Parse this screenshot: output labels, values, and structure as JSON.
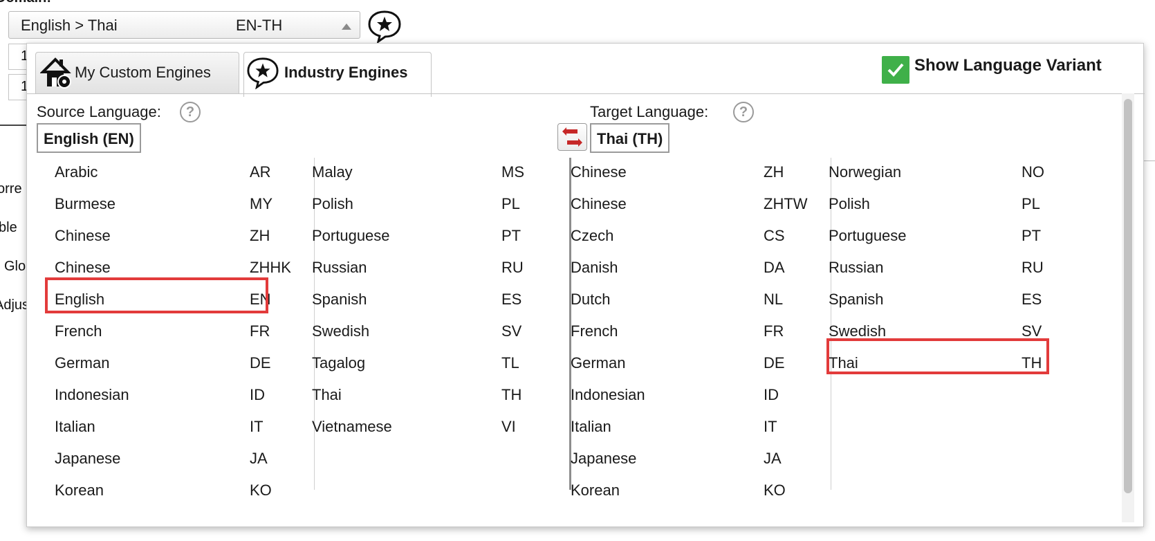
{
  "domain": {
    "label": "Domain:",
    "selected_name": "English > Thai",
    "selected_code": "EN-TH",
    "star_icon": "star-bubble-icon"
  },
  "background": {
    "field1_text": "1",
    "field2_text": "1",
    "line1": "orre",
    "line2": "ble",
    "line3": "Glo",
    "line4": "Adjus"
  },
  "tabs": [
    {
      "label": "My Custom Engines",
      "icon": "home-gear-icon",
      "active": false
    },
    {
      "label": "Industry Engines",
      "icon": "star-bubble-icon",
      "active": true
    }
  ],
  "variant": {
    "label": "Show Language Variant",
    "checked": true,
    "color": "#3fb049"
  },
  "source": {
    "label": "Source Language:",
    "selected": "English (EN)",
    "columns": [
      [
        {
          "name": "Arabic",
          "code": "AR"
        },
        {
          "name": "Burmese",
          "code": "MY"
        },
        {
          "name": "Chinese",
          "code": "ZH"
        },
        {
          "name": "Chinese",
          "code": "ZHHK"
        },
        {
          "name": "English",
          "code": "EN"
        },
        {
          "name": "French",
          "code": "FR"
        },
        {
          "name": "German",
          "code": "DE"
        },
        {
          "name": "Indonesian",
          "code": "ID"
        },
        {
          "name": "Italian",
          "code": "IT"
        },
        {
          "name": "Japanese",
          "code": "JA"
        },
        {
          "name": "Korean",
          "code": "KO"
        }
      ],
      [
        {
          "name": "Malay",
          "code": "MS"
        },
        {
          "name": "Polish",
          "code": "PL"
        },
        {
          "name": "Portuguese",
          "code": "PT"
        },
        {
          "name": "Russian",
          "code": "RU"
        },
        {
          "name": "Spanish",
          "code": "ES"
        },
        {
          "name": "Swedish",
          "code": "SV"
        },
        {
          "name": "Tagalog",
          "code": "TL"
        },
        {
          "name": "Thai",
          "code": "TH"
        },
        {
          "name": "Vietnamese",
          "code": "VI"
        }
      ]
    ]
  },
  "target": {
    "label": "Target Language:",
    "selected": "Thai (TH)",
    "columns": [
      [
        {
          "name": "Chinese",
          "code": "ZH"
        },
        {
          "name": "Chinese",
          "code": "ZHTW"
        },
        {
          "name": "Czech",
          "code": "CS"
        },
        {
          "name": "Danish",
          "code": "DA"
        },
        {
          "name": "Dutch",
          "code": "NL"
        },
        {
          "name": "French",
          "code": "FR"
        },
        {
          "name": "German",
          "code": "DE"
        },
        {
          "name": "Indonesian",
          "code": "ID"
        },
        {
          "name": "Italian",
          "code": "IT"
        },
        {
          "name": "Japanese",
          "code": "JA"
        },
        {
          "name": "Korean",
          "code": "KO"
        }
      ],
      [
        {
          "name": "Norwegian",
          "code": "NO"
        },
        {
          "name": "Polish",
          "code": "PL"
        },
        {
          "name": "Portuguese",
          "code": "PT"
        },
        {
          "name": "Russian",
          "code": "RU"
        },
        {
          "name": "Spanish",
          "code": "ES"
        },
        {
          "name": "Swedish",
          "code": "SV"
        },
        {
          "name": "Thai",
          "code": "TH"
        }
      ]
    ]
  },
  "help_glyph": "?",
  "highlight_color": "#e23b3b",
  "swap_icon": "swap-arrows-icon"
}
